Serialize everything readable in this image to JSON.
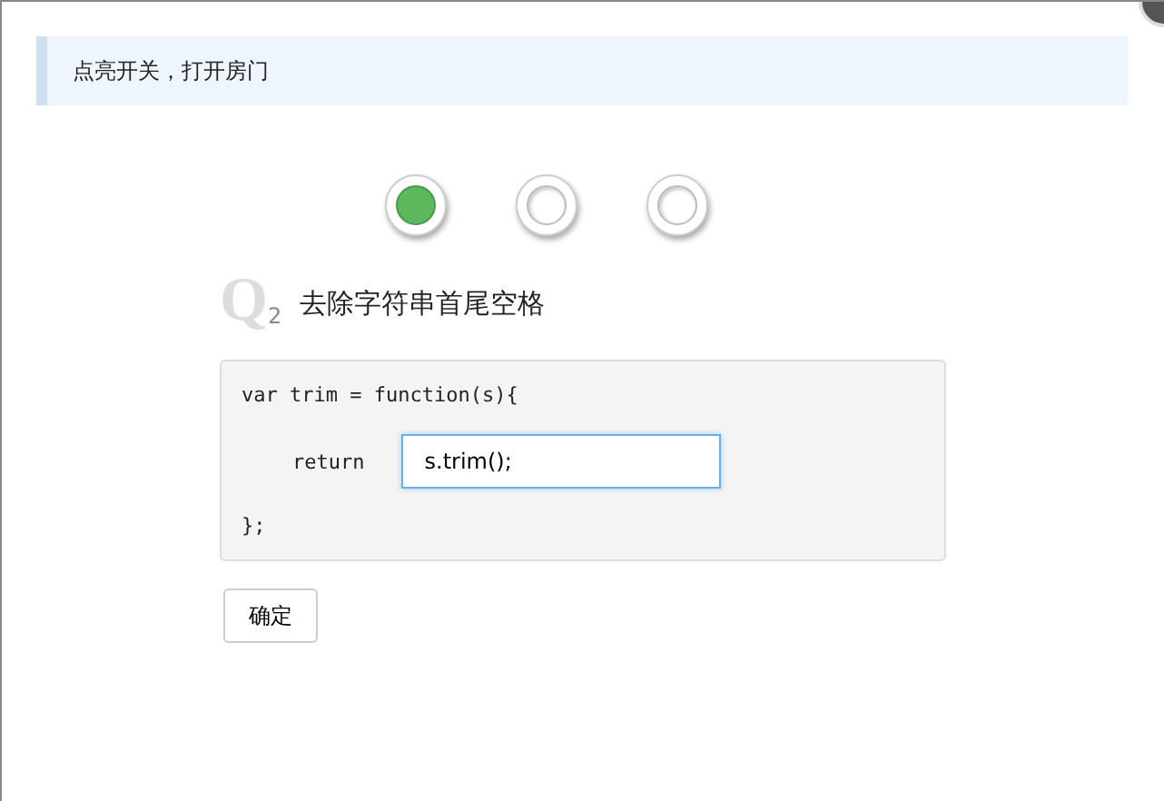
{
  "notice": "点亮开关，打开房门",
  "switches": [
    {
      "on": true
    },
    {
      "on": false
    },
    {
      "on": false
    }
  ],
  "question": {
    "letter": "Q",
    "number": "2",
    "title": "去除字符串首尾空格"
  },
  "code": {
    "line_1": "var trim = function(s){",
    "keyword": "return",
    "answer": "s.trim();",
    "line_3": "};"
  },
  "submit": "确定"
}
